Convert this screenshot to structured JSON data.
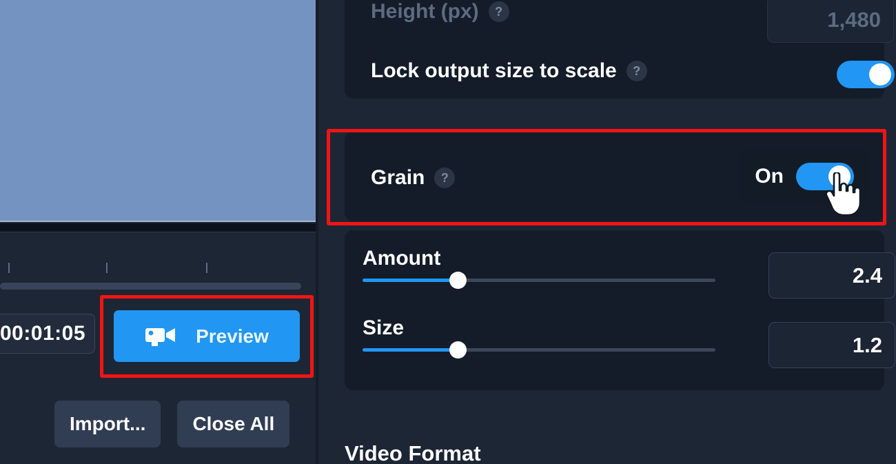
{
  "colors": {
    "accent": "#2196f3",
    "highlight": "#f11414",
    "panel_bg": "#1d2634",
    "card_bg": "#141c29",
    "preview_canvas": "#7493c1",
    "text": "#ffffff",
    "text_dim": "#5d6b80"
  },
  "left_panel": {
    "preview_canvas_name": "video-preview-canvas",
    "timeline": {
      "timecode_value": "00:01:05",
      "tick_count": 3
    },
    "preview_button": {
      "label": "Preview",
      "icon": "video-camera-icon",
      "highlighted": true
    },
    "footer_buttons": [
      {
        "label": "Import..."
      },
      {
        "label": "Close All"
      }
    ]
  },
  "right_panel": {
    "output_size_card": {
      "height_row": {
        "label": "Height (px)",
        "help": "?",
        "value": "1,480",
        "disabled": true
      },
      "lock_row": {
        "label": "Lock output size to scale",
        "help": "?",
        "toggle_on": true
      }
    },
    "grain_card": {
      "label": "Grain",
      "help": "?",
      "state_label": "On",
      "toggle_on": true,
      "highlighted": true,
      "cursor": "pointing-hand-cursor"
    },
    "grain_sliders_card": {
      "sliders": [
        {
          "label": "Amount",
          "value": "2.4",
          "percent": 27
        },
        {
          "label": "Size",
          "value": "1.2",
          "percent": 27
        }
      ]
    },
    "video_format_heading": "Video Format"
  }
}
